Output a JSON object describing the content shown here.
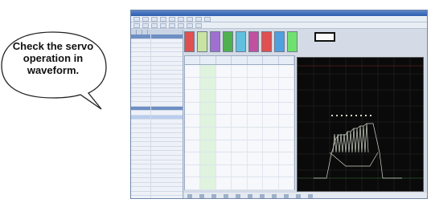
{
  "callout": {
    "lines": [
      "Check the servo",
      "operation in",
      "waveform."
    ]
  },
  "window": {
    "title": "",
    "menu": [
      "",
      "",
      "",
      "",
      "",
      "",
      "",
      "",
      ""
    ],
    "toolbar": [
      "",
      "",
      "",
      "",
      "",
      "",
      "",
      ""
    ],
    "left_tabs": [
      "",
      "",
      ""
    ],
    "dialog_button": ""
  },
  "colors": {
    "tool_icons": [
      "#e05050",
      "#c8e4a0",
      "#a070d0",
      "#50b050",
      "#60c0e0",
      "#c050a0",
      "#e05050",
      "#50a0e0",
      "#70e070"
    ],
    "scope_background": "#0a0a0a",
    "trace": "#cfd7c8"
  },
  "icons": [
    "speech-bubble",
    "scope-waveform"
  ]
}
